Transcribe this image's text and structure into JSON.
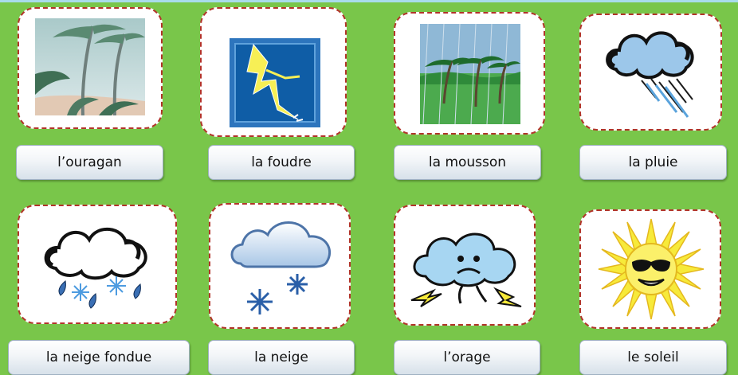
{
  "cards": [
    {
      "label": "l’ouragan",
      "icon": "hurricane-icon"
    },
    {
      "label": "la foudre",
      "icon": "lightning-icon"
    },
    {
      "label": "la mousson",
      "icon": "monsoon-icon"
    },
    {
      "label": "la pluie",
      "icon": "rain-icon"
    },
    {
      "label": "la neige fondue",
      "icon": "sleet-icon"
    },
    {
      "label": "la neige",
      "icon": "snow-icon"
    },
    {
      "label": "l’orage",
      "icon": "storm-icon"
    },
    {
      "label": "le soleil",
      "icon": "sun-icon"
    }
  ],
  "colors": {
    "background": "#79c64a",
    "card_border": "#b2342a"
  }
}
